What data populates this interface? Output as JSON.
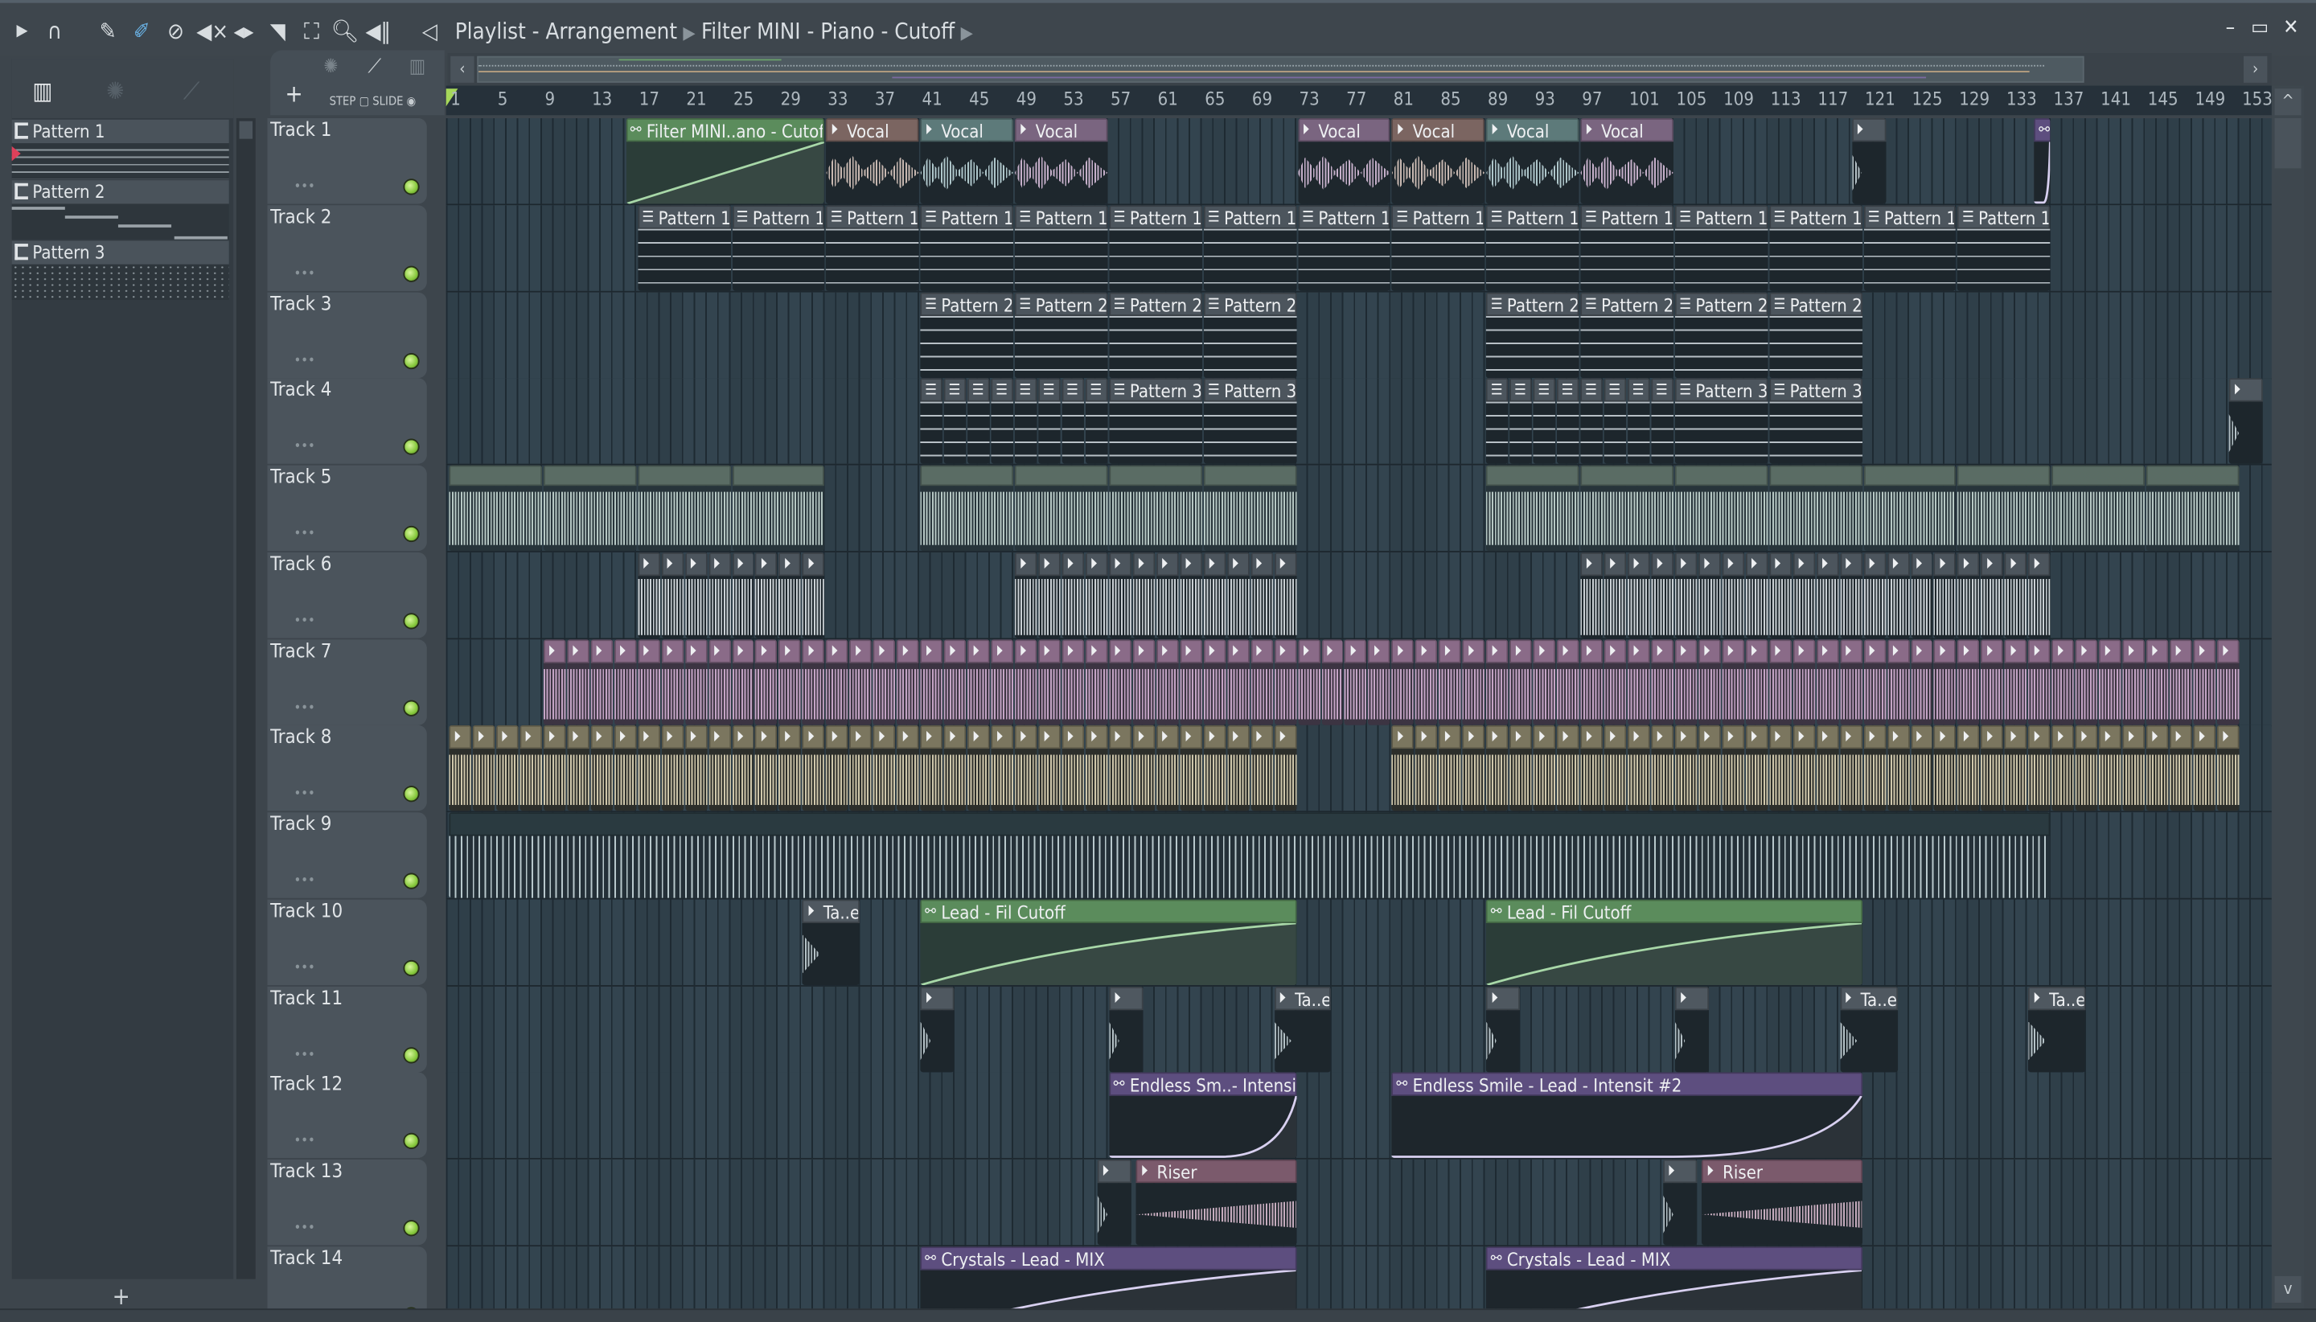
{
  "toolbar": {
    "breadcrumb": [
      "Playlist - Arrangement",
      "Filter MINI - Piano - Cutoff"
    ],
    "tools": [
      "play-arrow",
      "magnet",
      "pencil",
      "paint",
      "delete",
      "mute",
      "slip",
      "slice",
      "select",
      "zoom",
      "playback",
      "speaker"
    ]
  },
  "browser": {
    "patterns": [
      {
        "label": "Pattern 1"
      },
      {
        "label": "Pattern 2"
      },
      {
        "label": "Pattern 3"
      }
    ],
    "add_label": "+"
  },
  "playlist": {
    "add_label": "+",
    "step_label": "STEP",
    "slide_label": "SLIDE"
  },
  "ruler": {
    "bars": [
      1,
      5,
      9,
      13,
      17,
      21,
      25,
      29,
      33,
      37,
      41,
      45,
      49,
      53,
      57,
      61,
      65,
      69,
      73,
      77,
      81,
      85,
      89,
      93,
      97,
      101,
      105,
      109,
      113,
      117,
      121,
      125,
      129,
      133,
      137,
      141,
      145,
      149,
      153
    ]
  },
  "colors": {
    "accent": "#a6d85a",
    "automation": "#5b8c5c",
    "automation_purple": "#5d4e7f",
    "led": "#86c83c"
  },
  "tracks": [
    {
      "name": "Track 1",
      "clips": [
        {
          "start": 16,
          "length": 17,
          "label": "Filter MINI..ano - Cutoff",
          "kind": "auto",
          "curve": "up"
        },
        {
          "start": 33,
          "length": 8,
          "label": "Vocal",
          "kind": "voc1"
        },
        {
          "start": 41,
          "length": 8,
          "label": "Vocal",
          "kind": "voc2"
        },
        {
          "start": 49,
          "length": 8,
          "label": "Vocal",
          "kind": "voc3"
        },
        {
          "start": 73,
          "length": 8,
          "label": "Vocal",
          "kind": "voc3"
        },
        {
          "start": 81,
          "length": 8,
          "label": "Vocal",
          "kind": "voc1"
        },
        {
          "start": 89,
          "length": 8,
          "label": "Vocal",
          "kind": "voc2"
        },
        {
          "start": 97,
          "length": 8,
          "label": "Vocal",
          "kind": "voc3"
        },
        {
          "start": 120,
          "length": 3,
          "label": "",
          "kind": "shot"
        },
        {
          "start": 135.5,
          "length": 1.5,
          "label": "",
          "kind": "autop",
          "curve": "exp"
        }
      ]
    },
    {
      "name": "Track 2",
      "clips": [
        {
          "start": 17,
          "length": 8,
          "repeat": 15,
          "label": "Pattern 1",
          "kind": "pat"
        }
      ]
    },
    {
      "name": "Track 3",
      "clips": [
        {
          "start": 41,
          "length": 8,
          "repeat": 4,
          "label": "Pattern 2",
          "kind": "pat"
        },
        {
          "start": 89,
          "length": 8,
          "repeat": 4,
          "label": "Pattern 2",
          "kind": "pat"
        }
      ]
    },
    {
      "name": "Track 4",
      "clips": [
        {
          "start": 41,
          "length": 2,
          "repeat": 8,
          "label": "",
          "kind": "pat"
        },
        {
          "start": 57,
          "length": 8,
          "repeat": 2,
          "label": "Pattern 3",
          "kind": "pat"
        },
        {
          "start": 89,
          "length": 2,
          "repeat": 8,
          "label": "",
          "kind": "pat"
        },
        {
          "start": 105,
          "length": 8,
          "repeat": 2,
          "label": "Pattern 3",
          "kind": "pat"
        },
        {
          "start": 152,
          "length": 3,
          "label": "",
          "kind": "shot"
        }
      ]
    },
    {
      "name": "Track 5",
      "clips": [
        {
          "start": 1,
          "length": 8,
          "repeat": 4,
          "label": "",
          "kind": "t5"
        },
        {
          "start": 41,
          "length": 8,
          "repeat": 4,
          "label": "",
          "kind": "t5"
        },
        {
          "start": 89,
          "length": 8,
          "repeat": 4,
          "label": "",
          "kind": "t5"
        },
        {
          "start": 121,
          "length": 8,
          "repeat": 4,
          "label": "",
          "kind": "t5"
        }
      ]
    },
    {
      "name": "Track 6",
      "clips": [
        {
          "start": 17,
          "length": 2,
          "repeat": 8,
          "label": "",
          "kind": "t6"
        },
        {
          "start": 49,
          "length": 2,
          "repeat": 12,
          "label": "",
          "kind": "t6"
        },
        {
          "start": 97,
          "length": 2,
          "repeat": 20,
          "label": "",
          "kind": "t6"
        }
      ]
    },
    {
      "name": "Track 7",
      "clips": [
        {
          "start": 9,
          "length": 2,
          "repeat": 72,
          "label": "",
          "kind": "t7"
        }
      ]
    },
    {
      "name": "Track 8",
      "clips": [
        {
          "start": 1,
          "length": 2,
          "repeat": 36,
          "label": "",
          "kind": "t8"
        },
        {
          "start": 81,
          "length": 2,
          "repeat": 36,
          "label": "",
          "kind": "t8"
        }
      ]
    },
    {
      "name": "Track 9",
      "clips": [
        {
          "start": 1,
          "length": 136,
          "label": "",
          "kind": "t9"
        }
      ]
    },
    {
      "name": "Track 10",
      "clips": [
        {
          "start": 31,
          "length": 5,
          "label": "Ta..e",
          "kind": "shot"
        },
        {
          "start": 41,
          "length": 32,
          "label": "Lead - Fil Cutoff",
          "kind": "auto",
          "curve": "log"
        },
        {
          "start": 89,
          "length": 32,
          "label": "Lead - Fil Cutoff",
          "kind": "auto",
          "curve": "log"
        }
      ]
    },
    {
      "name": "Track 11",
      "clips": [
        {
          "start": 41,
          "length": 3,
          "label": "",
          "kind": "shot"
        },
        {
          "start": 57,
          "length": 3,
          "label": "",
          "kind": "shot"
        },
        {
          "start": 71,
          "length": 5,
          "label": "Ta..e",
          "kind": "shot"
        },
        {
          "start": 89,
          "length": 3,
          "label": "",
          "kind": "shot"
        },
        {
          "start": 105,
          "length": 3,
          "label": "",
          "kind": "shot"
        },
        {
          "start": 119,
          "length": 5,
          "label": "Ta..e",
          "kind": "shot"
        },
        {
          "start": 135,
          "length": 5,
          "label": "Ta..e",
          "kind": "shot"
        }
      ]
    },
    {
      "name": "Track 12",
      "clips": [
        {
          "start": 57,
          "length": 16,
          "label": "Endless Sm..- Intensit",
          "kind": "autop",
          "curve": "exp"
        },
        {
          "start": 81,
          "length": 40,
          "label": "Endless Smile - Lead - Intensit #2",
          "kind": "autop",
          "curve": "exp"
        }
      ]
    },
    {
      "name": "Track 13",
      "clips": [
        {
          "start": 56,
          "length": 3,
          "label": "",
          "kind": "shot"
        },
        {
          "start": 59.3,
          "length": 13.7,
          "label": "Riser",
          "kind": "riser"
        },
        {
          "start": 104,
          "length": 3,
          "label": "",
          "kind": "shot"
        },
        {
          "start": 107.3,
          "length": 13.7,
          "label": "Riser",
          "kind": "riser"
        }
      ]
    },
    {
      "name": "Track 14",
      "clips": [
        {
          "start": 41,
          "length": 32,
          "label": "Crystals - Lead - MIX",
          "kind": "autop",
          "curve": "log"
        },
        {
          "start": 89,
          "length": 32,
          "label": "Crystals - Lead - MIX",
          "kind": "autop",
          "curve": "log"
        }
      ]
    }
  ]
}
